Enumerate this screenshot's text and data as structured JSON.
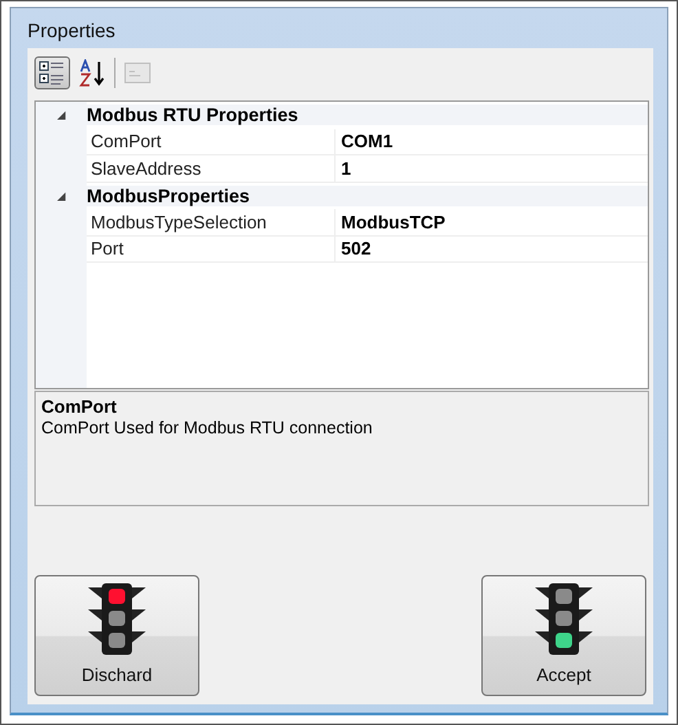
{
  "panel": {
    "title": "Properties"
  },
  "toolbar": [
    {
      "kind": "categorized",
      "selected": true,
      "disabled": false
    },
    {
      "kind": "alphabetical",
      "selected": false,
      "disabled": false
    },
    {
      "kind": "pages",
      "selected": false,
      "disabled": true
    }
  ],
  "categories": [
    {
      "name": "Modbus RTU Properties",
      "expanded": true,
      "glyph": "◢",
      "properties": [
        {
          "name": "ComPort",
          "value": "COM1"
        },
        {
          "name": "SlaveAddress",
          "value": "1"
        }
      ]
    },
    {
      "name": "ModbusProperties",
      "expanded": true,
      "glyph": "◢",
      "properties": [
        {
          "name": "ModbusTypeSelection",
          "value": "ModbusTCP"
        },
        {
          "name": "Port",
          "value": "502"
        }
      ]
    }
  ],
  "description": {
    "title": "ComPort",
    "text": "ComPort Used for Modbus RTU connection"
  },
  "buttons": [
    {
      "label": "Dischard",
      "kind": "stop"
    },
    {
      "label": "Accept",
      "kind": "go"
    }
  ]
}
